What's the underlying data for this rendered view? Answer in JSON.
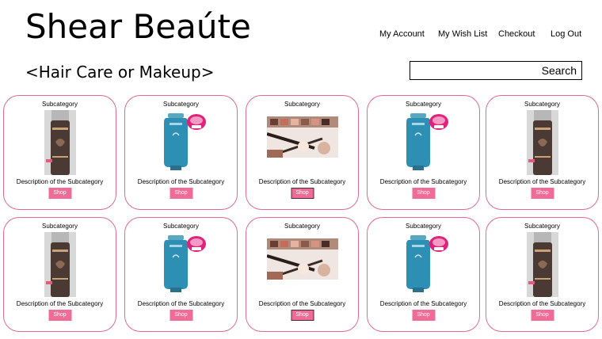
{
  "header": {
    "brand": "Shear Beaúte",
    "nav": [
      "My Account",
      "My Wish List",
      "Checkout",
      "Log Out"
    ]
  },
  "category_title": "<Hair Care or Makeup>",
  "search": {
    "label": "Search"
  },
  "products": [
    {
      "subcategory": "Subcategory",
      "description": "Description of the Subcategory",
      "shop": "Shop",
      "image": "hair-spray-bottle"
    },
    {
      "subcategory": "Subcategory",
      "description": "Description of the Subcategory",
      "shop": "Shop",
      "image": "conditioner-bottle",
      "badge": "NOVA"
    },
    {
      "subcategory": "Subcategory",
      "description": "Description of the Subcategory",
      "shop": "Shop",
      "image": "makeup-palette"
    },
    {
      "subcategory": "Subcategory",
      "description": "Description of the Subcategory",
      "shop": "Shop",
      "image": "conditioner-bottle",
      "badge": "NOVA"
    },
    {
      "subcategory": "Subcategory",
      "description": "Description of the Subcategory",
      "shop": "Shop",
      "image": "hair-spray-bottle"
    },
    {
      "subcategory": "Subcategory",
      "description": "Description of the Subcategory",
      "shop": "Shop",
      "image": "hair-spray-bottle"
    },
    {
      "subcategory": "Subcategory",
      "description": "Description of the Subcategory",
      "shop": "Shop",
      "image": "conditioner-bottle",
      "badge": "NOVA"
    },
    {
      "subcategory": "Subcategory",
      "description": "Description of the Subcategory",
      "shop": "Shop",
      "image": "makeup-palette"
    },
    {
      "subcategory": "Subcategory",
      "description": "Description of the Subcategory",
      "shop": "Shop",
      "image": "conditioner-bottle",
      "badge": "NOVA"
    },
    {
      "subcategory": "Subcategory",
      "description": "Description of the Subcategory",
      "shop": "Shop",
      "image": "hair-spray-bottle"
    }
  ],
  "colors": {
    "card_border": "#e06b8c",
    "shop_button": "#f06c96"
  }
}
